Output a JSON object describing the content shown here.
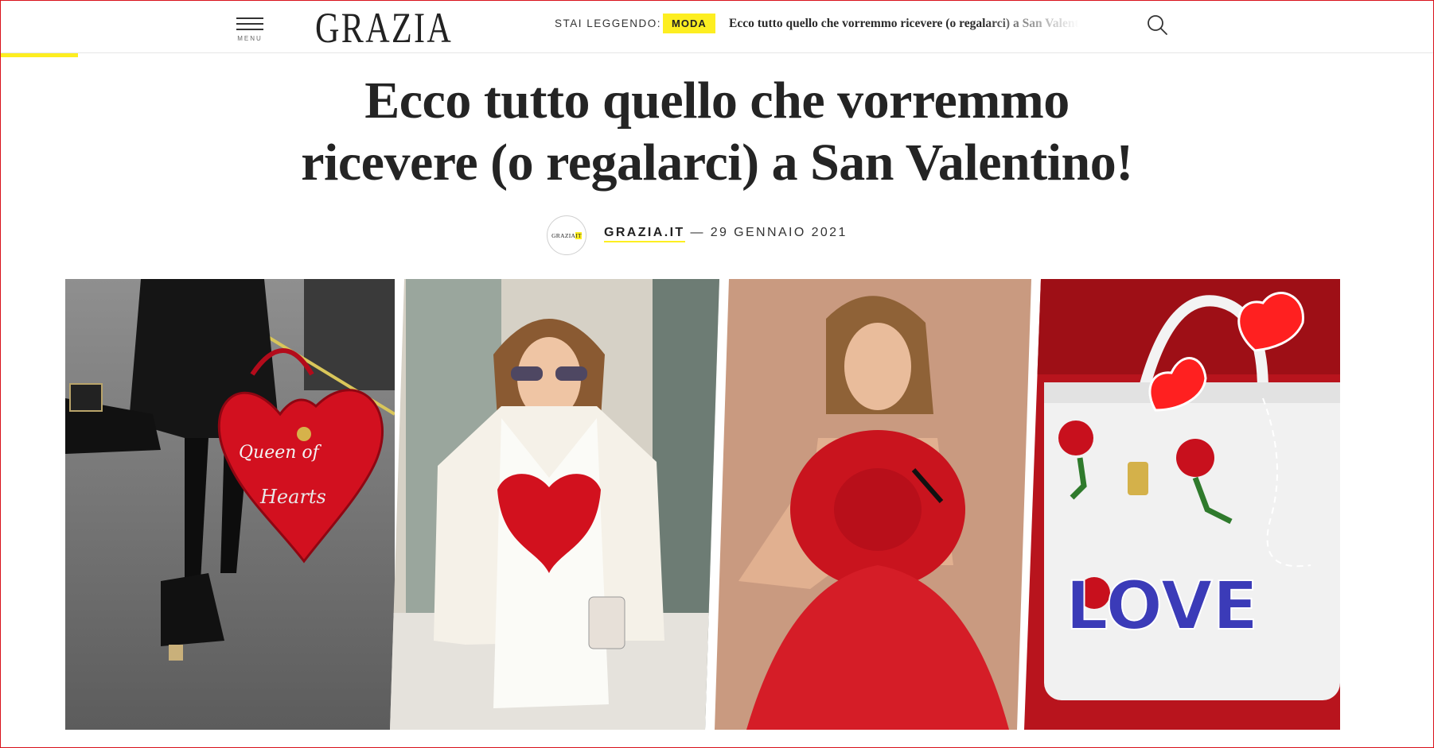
{
  "header": {
    "menu_label": "MENU",
    "logo_text": "GRAZIA",
    "reading_label": "STAI LEGGENDO:",
    "category_badge": "MODA",
    "reading_title": "Ecco tutto quello che vorremmo ricevere (o regalarci) a San Valentino!",
    "search_icon": "search-icon",
    "menu_icon": "hamburger-menu-icon"
  },
  "colors": {
    "accent_yellow": "#fdee21",
    "text_dark": "#242424",
    "frame_red": "#d8121b"
  },
  "article": {
    "headline_line1": "Ecco tutto quello che vorremmo",
    "headline_line2": "ricevere (o regalarci) a San Valentino!",
    "author_logo_text": "GRAZIA",
    "author_logo_suffix": "IT",
    "author": "GRAZIA.IT",
    "separator": " — ",
    "date": "29 GENNAIO 2021"
  },
  "gallery": {
    "bag1_text_a": "Queen of",
    "bag1_text_b": "Hearts",
    "bag4_text": "LOVE"
  }
}
